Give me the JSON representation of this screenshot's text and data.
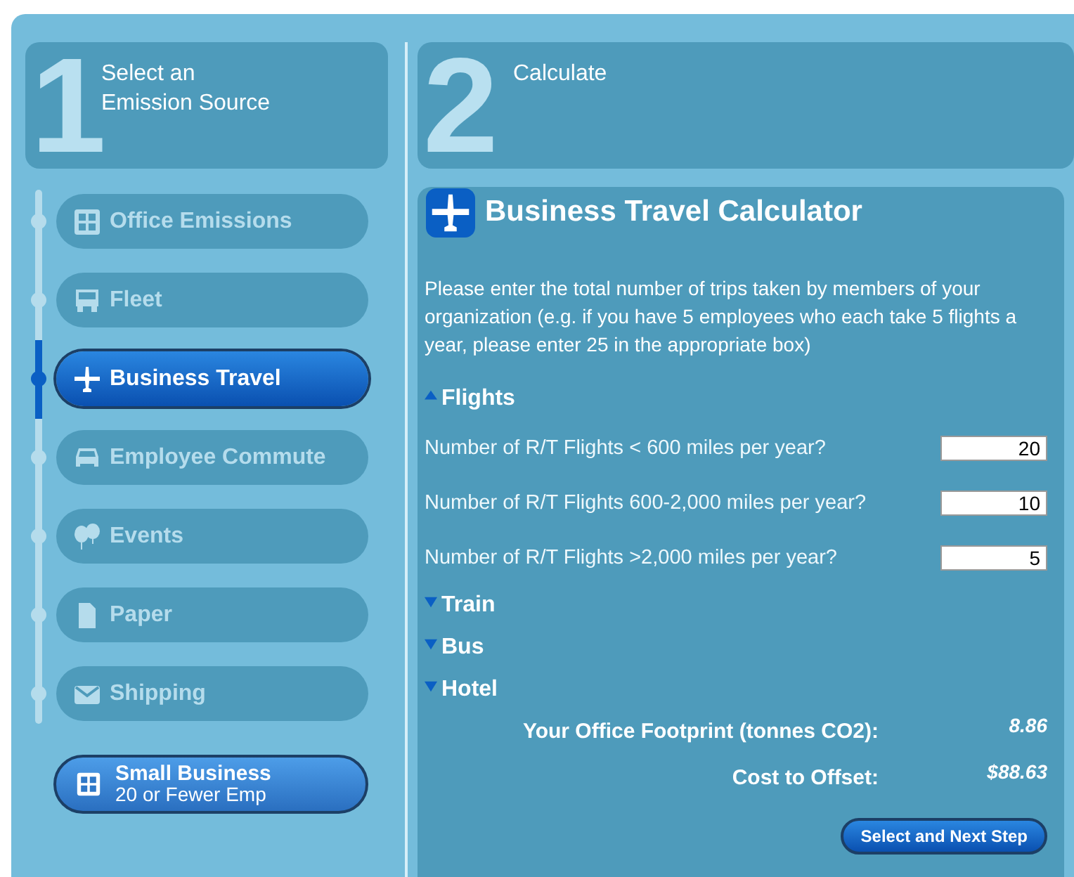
{
  "steps": [
    {
      "number": "1",
      "title_lines": [
        "Select an",
        "Emission Source"
      ]
    },
    {
      "number": "2",
      "title_lines": [
        "Calculate"
      ]
    }
  ],
  "sources": [
    {
      "label": "Office Emissions",
      "selected": false
    },
    {
      "label": "Fleet",
      "selected": false
    },
    {
      "label": "Business Travel",
      "selected": true
    },
    {
      "label": "Employee Commute",
      "selected": false
    },
    {
      "label": "Events",
      "selected": false
    },
    {
      "label": "Paper",
      "selected": false
    },
    {
      "label": "Shipping",
      "selected": false
    }
  ],
  "small_business": {
    "title": "Small Business",
    "subtitle": "20 or Fewer Emp"
  },
  "calculator": {
    "title": "Business Travel Calculator",
    "instructions": "Please enter the total number of trips taken by members of your organization (e.g. if you have 5 employees who each take 5 flights a year, please enter 25 in the appropriate box)",
    "sections": [
      {
        "label": "Flights",
        "expanded": true,
        "fields": [
          {
            "label": "Number of R/T Flights < 600 miles per year?",
            "value": "20"
          },
          {
            "label": "Number of R/T Flights 600-2,000 miles per year?",
            "value": "10"
          },
          {
            "label": "Number of R/T Flights >2,000 miles per year?",
            "value": "5"
          }
        ]
      },
      {
        "label": "Train",
        "expanded": false
      },
      {
        "label": "Bus",
        "expanded": false
      },
      {
        "label": "Hotel",
        "expanded": false
      }
    ],
    "results": [
      {
        "label": "Your Office Footprint (tonnes CO2):",
        "value": "8.86"
      },
      {
        "label": "Cost to Offset:",
        "value": "$88.63"
      }
    ],
    "next_button": "Select and Next Step"
  }
}
